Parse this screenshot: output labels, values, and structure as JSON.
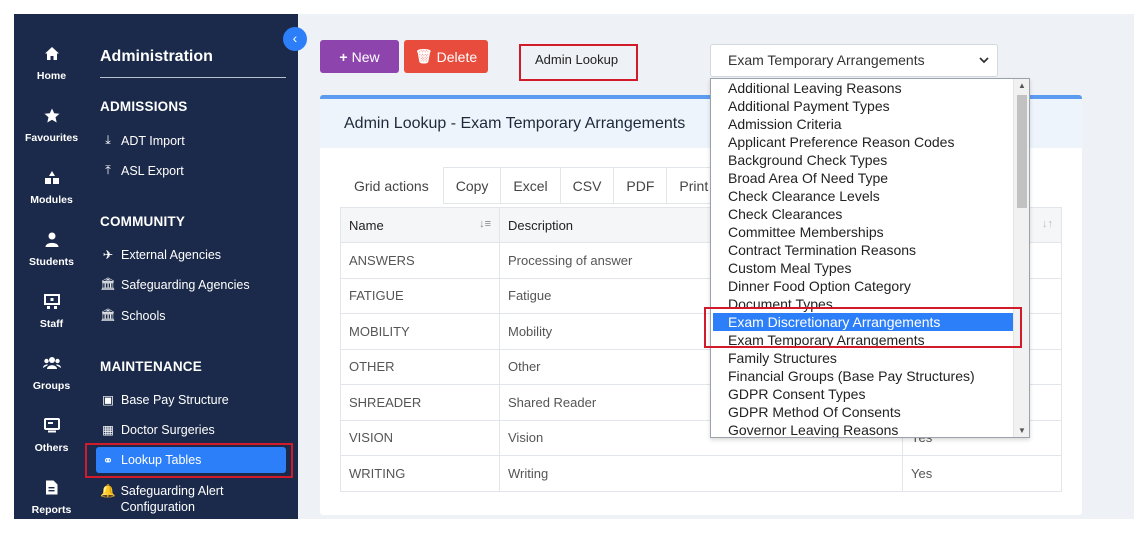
{
  "rail": [
    {
      "label": "Home",
      "icon": "home-icon"
    },
    {
      "label": "Favourites",
      "icon": "star-icon"
    },
    {
      "label": "Modules",
      "icon": "modules-icon"
    },
    {
      "label": "Students",
      "icon": "user-icon"
    },
    {
      "label": "Staff",
      "icon": "staff-icon"
    },
    {
      "label": "Groups",
      "icon": "groups-icon"
    },
    {
      "label": "Others",
      "icon": "others-icon"
    },
    {
      "label": "Reports",
      "icon": "reports-icon"
    }
  ],
  "sidebar": {
    "title": "Administration",
    "collapse_glyph": "‹",
    "sections": [
      {
        "heading": "ADMISSIONS",
        "items": [
          {
            "label": "ADT Import",
            "icon": "import-icon",
            "glyph": "⤓"
          },
          {
            "label": "ASL Export",
            "icon": "export-icon",
            "glyph": "⤒"
          }
        ]
      },
      {
        "heading": "COMMUNITY",
        "items": [
          {
            "label": "External Agencies",
            "icon": "send-icon",
            "glyph": "✈"
          },
          {
            "label": "Safeguarding Agencies",
            "icon": "building-icon",
            "glyph": "🏛"
          },
          {
            "label": "Schools",
            "icon": "school-icon",
            "glyph": "🏛"
          }
        ]
      },
      {
        "heading": "MAINTENANCE",
        "items": [
          {
            "label": "Base Pay Structure",
            "icon": "money-icon",
            "glyph": "▣"
          },
          {
            "label": "Doctor Surgeries",
            "icon": "hospital-icon",
            "glyph": "▦"
          },
          {
            "label": "Lookup Tables",
            "icon": "binoculars-icon",
            "glyph": "⚭",
            "active": true
          },
          {
            "label": "Safeguarding Alert Configuration",
            "icon": "bell-icon",
            "glyph": "🔔"
          }
        ]
      }
    ]
  },
  "toolbar": {
    "new_label": "New",
    "new_glyph": "+",
    "delete_label": "Delete",
    "delete_glyph": "🗑",
    "admin_lookup_label": "Admin Lookup",
    "lookup_select_value": "Exam Temporary Arrangements"
  },
  "card": {
    "title": "Admin Lookup - Exam Temporary Arrangements",
    "grid_actions": [
      "Grid actions",
      "Copy",
      "Excel",
      "CSV",
      "PDF",
      "Print"
    ],
    "columns": [
      "Name",
      "Description",
      ""
    ],
    "rows": [
      {
        "name": "ANSWERS",
        "description": "Processing of answer",
        "flag": ""
      },
      {
        "name": "FATIGUE",
        "description": "Fatigue",
        "flag": ""
      },
      {
        "name": "MOBILITY",
        "description": "Mobility",
        "flag": ""
      },
      {
        "name": "OTHER",
        "description": "Other",
        "flag": ""
      },
      {
        "name": "SHREADER",
        "description": "Shared Reader",
        "flag": ""
      },
      {
        "name": "VISION",
        "description": "Vision",
        "flag": "Yes"
      },
      {
        "name": "WRITING",
        "description": "Writing",
        "flag": "Yes"
      }
    ]
  },
  "dropdown": {
    "highlighted": "Exam Discretionary Arrangements",
    "options": [
      "Additional Leaving Reasons",
      "Additional Payment Types",
      "Admission Criteria",
      "Applicant Preference Reason Codes",
      "Background Check Types",
      "Broad Area Of Need Type",
      "Check Clearance Levels",
      "Check Clearances",
      "Committee Memberships",
      "Contract Termination Reasons",
      "Custom Meal Types",
      "Dinner Food Option Category",
      "Document Types",
      "Exam Discretionary Arrangements",
      "Exam Temporary Arrangements",
      "Family Structures",
      "Financial Groups (Base Pay Structures)",
      "GDPR Consent Types",
      "GDPR Method Of Consents",
      "Governor Leaving Reasons"
    ]
  },
  "colors": {
    "sidebar_bg": "#1b2a4a",
    "accent": "#2d7ff9",
    "new_button": "#8e44ad",
    "delete_button": "#e74c3c",
    "annotation_red": "#d11a2a"
  }
}
